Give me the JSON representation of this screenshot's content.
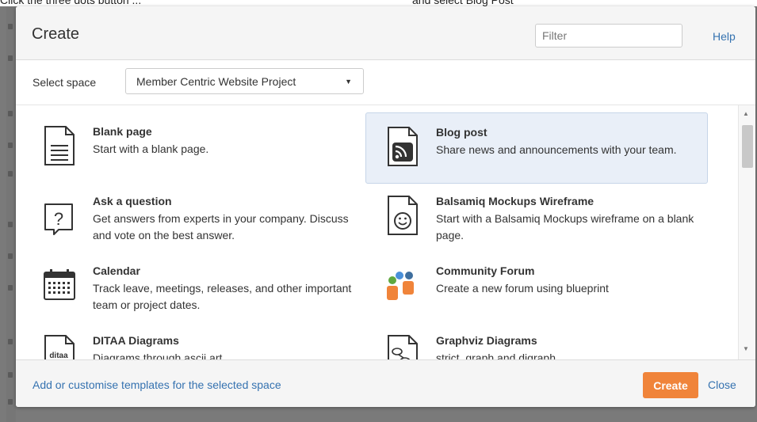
{
  "top_instruction": {
    "before": "Click the three dots button ...",
    "after": "and select Blog Post"
  },
  "dialog": {
    "title": "Create",
    "filter_placeholder": "Filter",
    "help_label": "Help",
    "select_space_label": "Select space",
    "space_value": "Member Centric Website Project",
    "templates": [
      {
        "name": "Blank page",
        "description": "Start with a blank page.",
        "icon": "blank-page-icon"
      },
      {
        "name": "Blog post",
        "description": "Share news and announcements with your team.",
        "icon": "blog-post-icon",
        "selected": true
      },
      {
        "name": "Ask a question",
        "description": "Get answers from experts in your company. Discuss and vote on the best answer.",
        "icon": "question-icon"
      },
      {
        "name": "Balsamiq Mockups Wireframe",
        "description": "Start with a Balsamiq Mockups wireframe on a blank page.",
        "icon": "balsamiq-icon"
      },
      {
        "name": "Calendar",
        "description": "Track leave, meetings, releases, and other important team or project dates.",
        "icon": "calendar-icon"
      },
      {
        "name": "Community Forum",
        "description": "Create a new forum using blueprint",
        "icon": "community-forum-icon"
      },
      {
        "name": "DITAA Diagrams",
        "description": "Diagrams through ascii art",
        "icon": "ditaa-icon",
        "icon_text": "ditaa"
      },
      {
        "name": "Graphviz Diagrams",
        "description": "strict, graph and digraph",
        "icon": "graphviz-icon"
      }
    ],
    "footer_link": "Add or customise templates for the selected space",
    "create_label": "Create",
    "close_label": "Close"
  },
  "colors": {
    "accent": "#f0843a",
    "link": "#3572b0",
    "selected_bg": "#e9eff8"
  }
}
